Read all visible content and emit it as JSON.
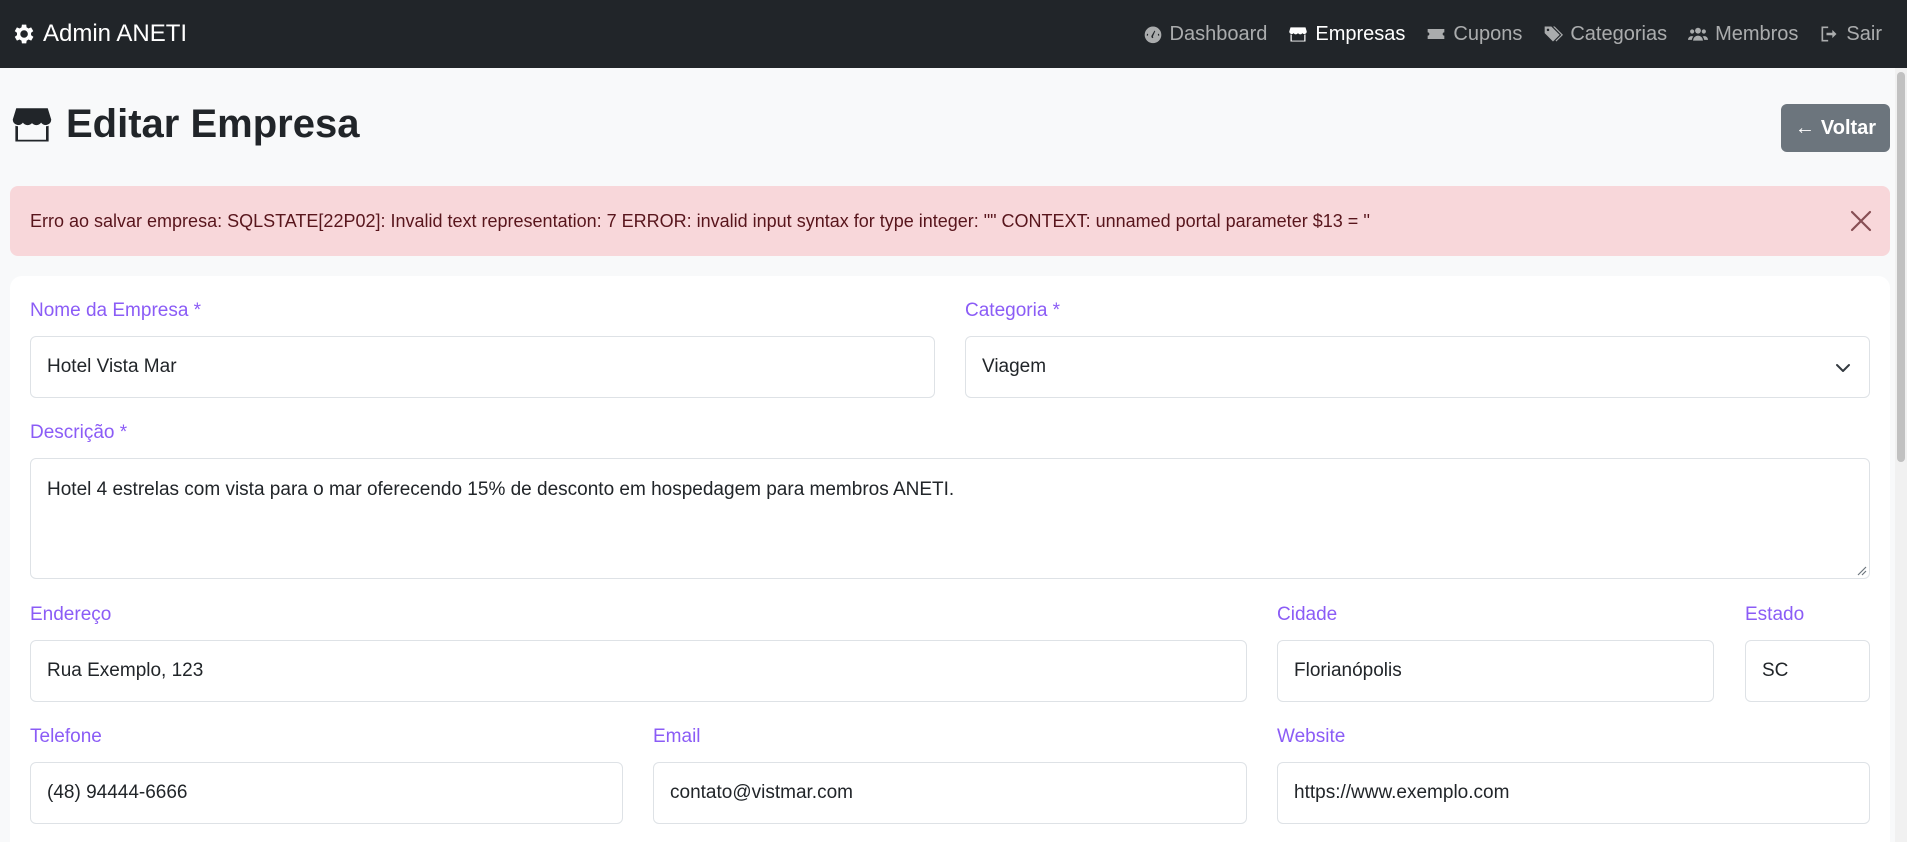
{
  "navbar": {
    "brand": "Admin ANETI",
    "brand_icon": "gear-icon",
    "items": [
      {
        "label": "Dashboard",
        "icon": "tachometer-icon",
        "active": false
      },
      {
        "label": "Empresas",
        "icon": "store-icon",
        "active": true
      },
      {
        "label": "Cupons",
        "icon": "ticket-icon",
        "active": false
      },
      {
        "label": "Categorias",
        "icon": "tags-icon",
        "active": false
      },
      {
        "label": "Membros",
        "icon": "users-icon",
        "active": false
      },
      {
        "label": "Sair",
        "icon": "sign-out-icon",
        "active": false
      }
    ]
  },
  "header": {
    "title": "Editar Empresa",
    "icon": "store-icon",
    "back_label": "Voltar"
  },
  "alert": {
    "message": "Erro ao salvar empresa: SQLSTATE[22P02]: Invalid text representation: 7 ERROR: invalid input syntax for type integer: \"\" CONTEXT: unnamed portal parameter $13 = ''"
  },
  "form": {
    "nome": {
      "label": "Nome da Empresa *",
      "value": "Hotel Vista Mar"
    },
    "categoria": {
      "label": "Categoria *",
      "value": "Viagem"
    },
    "descricao": {
      "label": "Descrição *",
      "value": "Hotel 4 estrelas com vista para o mar oferecendo 15% de desconto em hospedagem para membros ANETI."
    },
    "endereco": {
      "label": "Endereço",
      "value": "Rua Exemplo, 123"
    },
    "cidade": {
      "label": "Cidade",
      "value": "Florianópolis"
    },
    "estado": {
      "label": "Estado",
      "value": "SC"
    },
    "telefone": {
      "label": "Telefone",
      "value": "(48) 94444-6666"
    },
    "email": {
      "label": "Email",
      "value": "contato@vistmar.com"
    },
    "website": {
      "label": "Website",
      "value": "https://www.exemplo.com"
    }
  },
  "colors": {
    "navbar_bg": "#212529",
    "label": "#8b5cf6",
    "alert_bg": "#f8d7da",
    "back_button": "#6c757d"
  }
}
